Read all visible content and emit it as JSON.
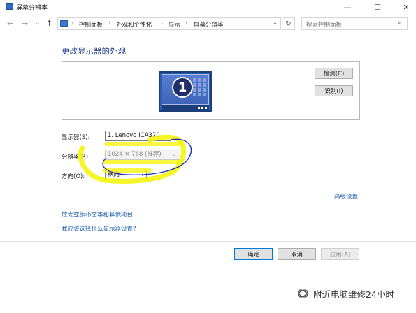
{
  "window": {
    "title": "屏幕分辨率",
    "minimize": "—",
    "maximize": "☐",
    "close": "✕"
  },
  "nav": {
    "back": "←",
    "forward": "→",
    "dropdown": "⌄",
    "up": "↑"
  },
  "breadcrumb": [
    "控制面板",
    "外观和个性化",
    "显示",
    "屏幕分辨率"
  ],
  "breadcrumb_separator": "›",
  "search": {
    "placeholder": "搜索控制面板"
  },
  "main": {
    "heading": "更改显示器的外观",
    "monitor_number": "1",
    "detect_button": "检测(C)",
    "identify_button": "识别(I)"
  },
  "settings": {
    "display_label": "显示器(S):",
    "display_value": "1. Lenovo ICA320",
    "resolution_label": "分辨率(R):",
    "resolution_value": "1024 × 768 (推荐)",
    "orientation_label": "方向(O):",
    "orientation_value": "横向"
  },
  "links": {
    "advanced": "高级设置",
    "text_size": "放大或缩小文本和其他项目",
    "which_settings": "我应该选择什么显示器设置?"
  },
  "footer": {
    "ok": "确定",
    "cancel": "取消",
    "apply": "应用(A)"
  },
  "watermark": {
    "text": "附近电脑维修24小时"
  },
  "colors": {
    "highlight": "#f5f500",
    "pen": "#1f2fbf",
    "link": "#1e5fb5",
    "heading": "#1e3c8c"
  }
}
